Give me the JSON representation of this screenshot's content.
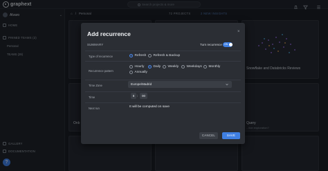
{
  "app": {
    "logo_text": "graphext"
  },
  "topbar": {
    "search_placeholder": "Search projects & more"
  },
  "sidebar": {
    "user_name": "Alvaro",
    "home": "HOME",
    "pinned": "PINNED TEAMS (2)",
    "pinned_items": [
      "Personal",
      "TEAMS (29)"
    ],
    "gallery": "GALLERY",
    "documentation": "DOCUMENTATION",
    "fab": "?"
  },
  "header": {
    "breadcrumb_current": "Personal",
    "projects_count": "72 PROJECTS",
    "info": "2 NEW INSIGHTS"
  },
  "background_cards": [
    {
      "title": "Snowflake and Databricks Reviews"
    },
    {
      "title": "Onb"
    },
    {
      "title": "Query",
      "subtitle": "...tion exploration?"
    }
  ],
  "modal": {
    "title": "Add recurrence",
    "close": "×",
    "summary_label": "SUMMARY",
    "turn_label": "Turn recurrence",
    "toggle_label": "ON",
    "type_label": "Type of recurrence",
    "type_options": [
      {
        "label": "Refresh",
        "selected": true
      },
      {
        "label": "Refresh & Backup",
        "selected": false
      }
    ],
    "pattern_label": "Recurrence pattern",
    "pattern_options": [
      {
        "label": "Hourly",
        "selected": false
      },
      {
        "label": "Daily",
        "selected": true
      },
      {
        "label": "Weekly",
        "selected": false
      },
      {
        "label": "Weekdays",
        "selected": false
      },
      {
        "label": "Monthly",
        "selected": false
      },
      {
        "label": "Annually",
        "selected": false
      }
    ],
    "timezone_label": "Time Zone",
    "timezone_value": "Europe/Madrid",
    "time_label": "Time",
    "time_hour": "8",
    "time_minute": "00",
    "time_sep": ":",
    "next_run_label": "Next run",
    "next_run_value": "It will be computed on save",
    "cancel_label": "CANCEL",
    "save_label": "SAVE"
  },
  "colors": {
    "accent": "#3f7fe2",
    "modal_bg": "#2b2e34",
    "page_bg": "#15171c"
  }
}
